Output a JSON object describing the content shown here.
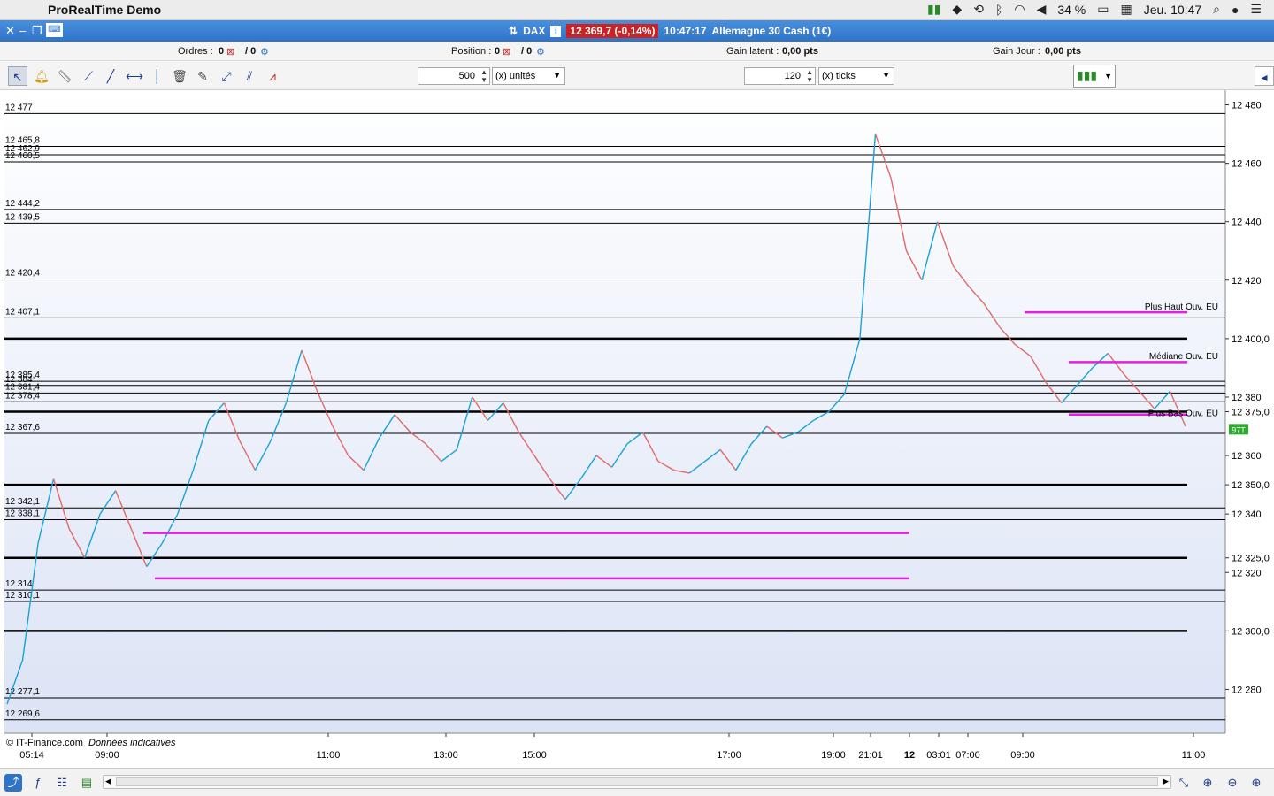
{
  "menubar": {
    "app_name": "ProRealTime Demo",
    "battery": "34 %",
    "clock": "Jeu. 10:47"
  },
  "titlebar": {
    "symbol": "DAX",
    "price_badge": "12 369,7 (-0,14%)",
    "timestamp": "10:47:17",
    "instrument": "Allemagne 30 Cash (1€)"
  },
  "status": {
    "orders_label": "Ordres :",
    "orders_value": "0",
    "orders_sep": "/ 0",
    "position_label": "Position :",
    "position_value": "0",
    "position_sep": "/ 0",
    "gain_latent_label": "Gain latent :",
    "gain_latent_value": "0,00 pts",
    "gain_jour_label": "Gain Jour :",
    "gain_jour_value": "0,00 pts"
  },
  "toolbar": {
    "qty_value": "500",
    "qty_unit": "(x) unités",
    "ticks_value": "120",
    "ticks_unit": "(x) ticks"
  },
  "chart_data": {
    "type": "line",
    "ylim": [
      12265,
      12485
    ],
    "y_ticks": [
      "12 480",
      "12 460",
      "12 440",
      "12 420",
      "12 400,0",
      "12 380",
      "12 375,0",
      "12 360",
      "12 350,0",
      "12 340",
      "12 325,0",
      "12 320",
      "12 300,0",
      "12 280"
    ],
    "y_tick_values": [
      12480,
      12460,
      12440,
      12420,
      12400,
      12380,
      12375,
      12360,
      12350,
      12340,
      12325,
      12320,
      12300,
      12280
    ],
    "x_ticks": [
      "05:14",
      "09:00",
      "11:00",
      "13:00",
      "15:00",
      "17:00",
      "19:00",
      "21:01",
      "12",
      "03:01",
      "07:00",
      "09:00",
      "11:00"
    ],
    "levels": [
      {
        "label": "12 477",
        "value": 12477
      },
      {
        "label": "12 465,8",
        "value": 12465.8
      },
      {
        "label": "12 462,9",
        "value": 12462.9
      },
      {
        "label": "12 460,5",
        "value": 12460.5
      },
      {
        "label": "12 444,2",
        "value": 12444.2
      },
      {
        "label": "12 439,5",
        "value": 12439.5
      },
      {
        "label": "12 420,4",
        "value": 12420.4
      },
      {
        "label": "12 407,1",
        "value": 12407.1
      },
      {
        "label": "12 385,4",
        "value": 12385.4
      },
      {
        "label": "12 384",
        "value": 12384
      },
      {
        "label": "12 381,4",
        "value": 12381.4
      },
      {
        "label": "12 378,4",
        "value": 12378.4
      },
      {
        "label": "12 367,6",
        "value": 12367.6
      },
      {
        "label": "12 342,1",
        "value": 12342.1
      },
      {
        "label": "12 338,1",
        "value": 12338.1
      },
      {
        "label": "12 314",
        "value": 12314
      },
      {
        "label": "12 310,1",
        "value": 12310.1
      },
      {
        "label": "12 277,1",
        "value": 12277.1
      },
      {
        "label": "12 269,6",
        "value": 12269.6
      }
    ],
    "annotations": [
      "Plus Haut Ouv. EU",
      "Médiane Ouv. EU",
      "Plus Bas Ouv. EU"
    ],
    "last_volume_badge": "97T",
    "series_close": [
      12275,
      12290,
      12330,
      12352,
      12335,
      12325,
      12340,
      12348,
      12335,
      12322,
      12330,
      12340,
      12355,
      12372,
      12378,
      12365,
      12355,
      12365,
      12378,
      12396,
      12382,
      12370,
      12360,
      12355,
      12366,
      12374,
      12368,
      12364,
      12358,
      12362,
      12380,
      12372,
      12378,
      12368,
      12360,
      12352,
      12345,
      12352,
      12360,
      12356,
      12364,
      12368,
      12358,
      12355,
      12354,
      12358,
      12362,
      12355,
      12364,
      12370,
      12366,
      12368,
      12372,
      12375,
      12381,
      12400,
      12470,
      12455,
      12430,
      12420,
      12440,
      12425,
      12418,
      12412,
      12404,
      12398,
      12394,
      12385,
      12378,
      12384,
      12390,
      12395,
      12388,
      12382,
      12376,
      12382,
      12370
    ],
    "colors": {
      "up": "#1aa1d8",
      "down": "#e06a6a",
      "magenta": "#e01fe0",
      "level": "#000000"
    }
  },
  "footer": {
    "credit": "© IT-Finance.com",
    "credit_note": "Données indicatives"
  }
}
